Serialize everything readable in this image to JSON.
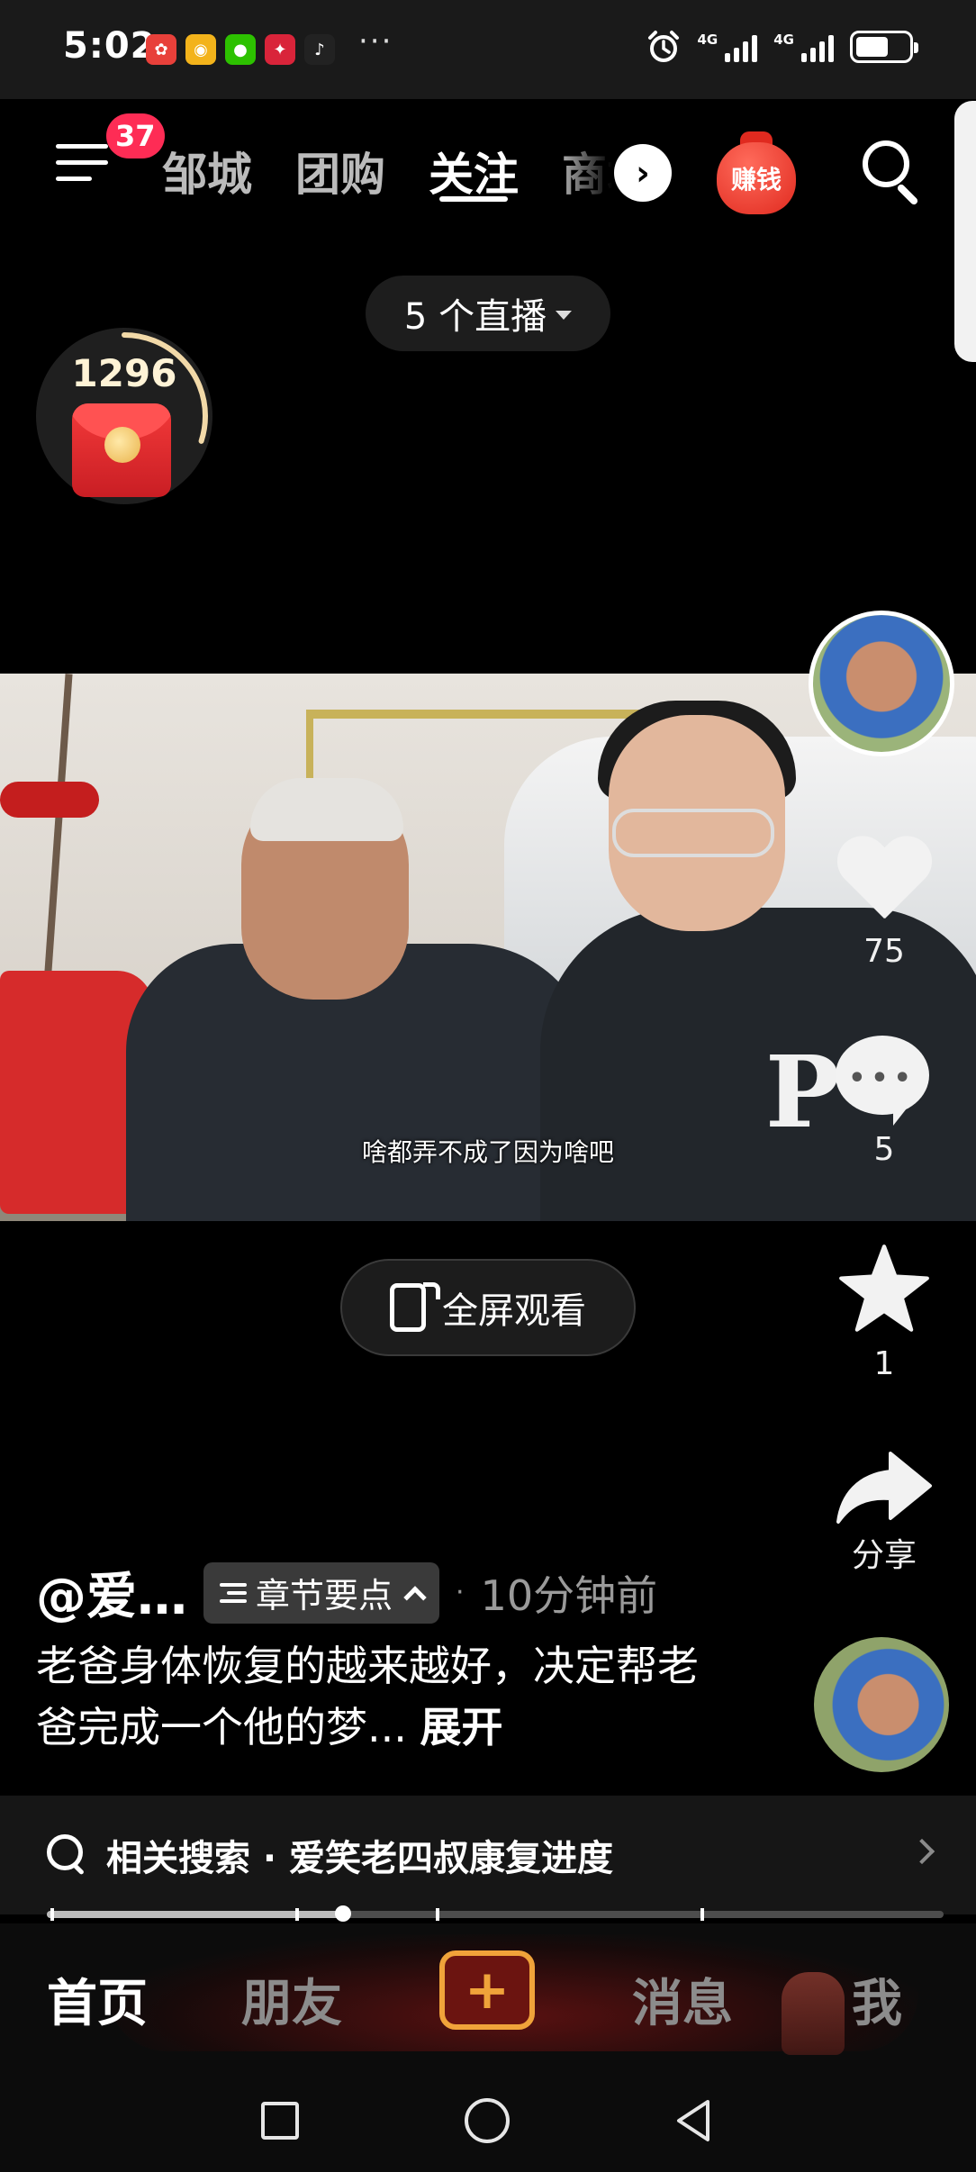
{
  "status_bar": {
    "time": "5:02",
    "more": "···",
    "network_1": "4G",
    "network_2": "4G"
  },
  "top_nav": {
    "notification_count": "37",
    "tabs": [
      "邹城",
      "团购",
      "关注",
      "商城"
    ],
    "active_tab_index": 2,
    "more_arrow": "›",
    "earn_label": "赚钱"
  },
  "live_pill": {
    "label": "5 个直播"
  },
  "red_packet": {
    "count": "1296",
    "progress": 0.3
  },
  "video": {
    "subtitle": "啥都弄不成了因为啥吧"
  },
  "fullscreen": {
    "label": "全屏观看"
  },
  "actions": {
    "likes": "75",
    "comments": "5",
    "favorites": "1",
    "share_label": "分享"
  },
  "post": {
    "author": "@爱…",
    "chapter_label": "章节要点",
    "time_sep": "·",
    "time": "10分钟前",
    "caption": "老爸身体恢复的越来越好，决定帮老爸完成一个他的梦...",
    "expand": "展开"
  },
  "related_search": {
    "text": "相关搜索 · 爱笑老四叔康复进度"
  },
  "playback": {
    "progress_percent": 33
  },
  "bottom_nav": {
    "items": [
      "首页",
      "朋友",
      "消息",
      "我"
    ],
    "add": "+"
  },
  "colors": {
    "accent": "#fe2c55",
    "add_button_border": "#f0a33a",
    "background": "#000000"
  }
}
